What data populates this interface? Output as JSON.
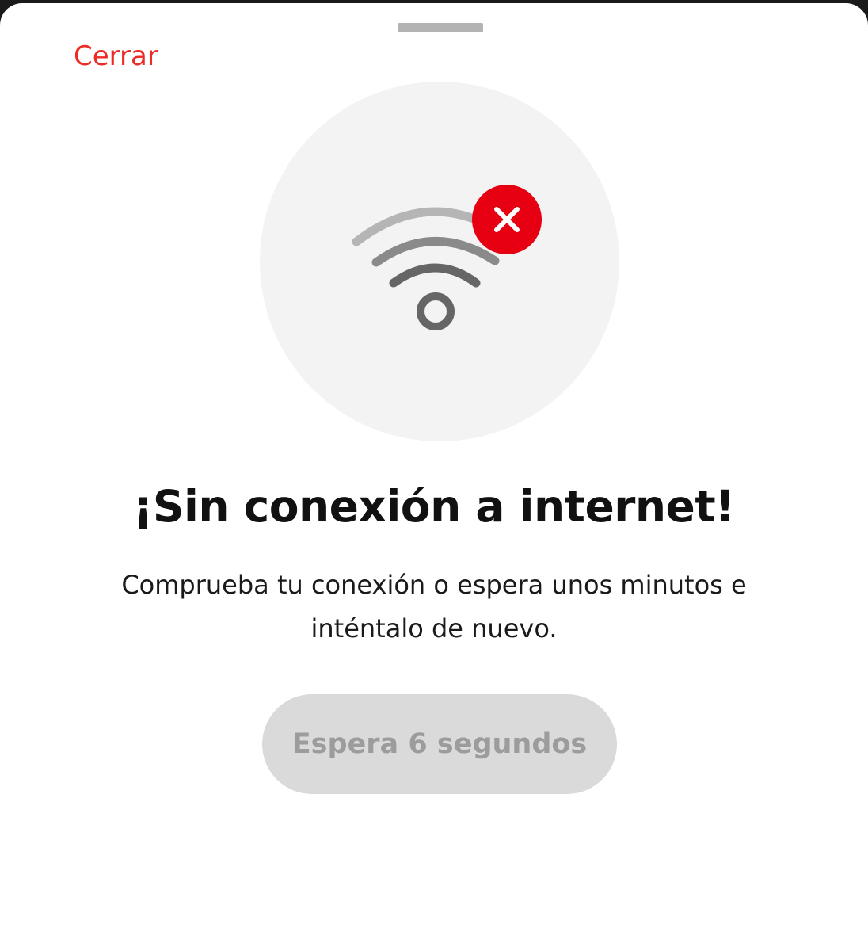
{
  "sheet": {
    "close_label": "Cerrar"
  },
  "illustration": {
    "icon": "wifi-off-icon",
    "badge_icon": "close-icon",
    "colors": {
      "circle_bg": "#f3f3f3",
      "wifi_light": "#b5b5b5",
      "wifi_mid": "#8a8a8a",
      "wifi_dark": "#666666",
      "badge": "#e60012"
    }
  },
  "content": {
    "title": "¡Sin conexión a internet!",
    "message": "Comprueba tu conexión o espera unos minutos e inténtalo de nuevo.",
    "wait_button_label": "Espera 6 segundos"
  },
  "colors": {
    "accent": "#ec2b25",
    "button_disabled_bg": "#dadada",
    "button_disabled_text": "#9c9c9c"
  }
}
